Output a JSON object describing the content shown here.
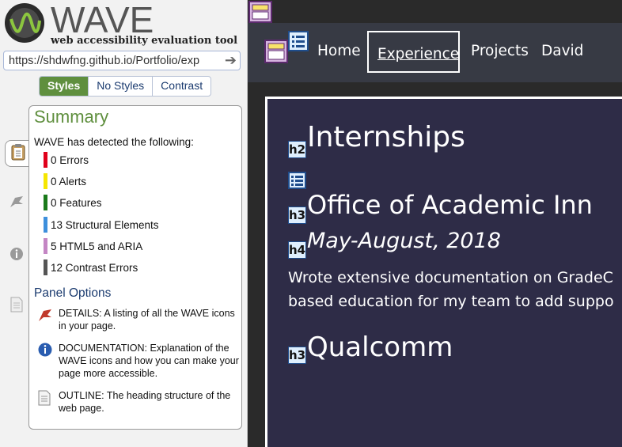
{
  "wave": {
    "logo_word": "WAVE",
    "tagline": "web accessibility evaluation tool",
    "url": "https://shdwfng.github.io/Portfolio/exp",
    "view_tabs": [
      {
        "label": "Styles",
        "active": true
      },
      {
        "label": "No Styles",
        "active": false
      },
      {
        "label": "Contrast",
        "active": false
      }
    ],
    "summary": {
      "title": "Summary",
      "intro": "WAVE has detected the following:",
      "stats": [
        {
          "label": "0 Errors",
          "color": "#e0001b"
        },
        {
          "label": "0 Alerts",
          "color": "#f5e600"
        },
        {
          "label": "0 Features",
          "color": "#1a7a1a"
        },
        {
          "label": "13 Structural Elements",
          "color": "#3d8fdc"
        },
        {
          "label": "5 HTML5 and ARIA",
          "color": "#c486c4"
        },
        {
          "label": "12 Contrast Errors",
          "color": "#555555"
        }
      ]
    },
    "panel_options": {
      "title": "Panel Options",
      "items": [
        {
          "icon": "flag-icon",
          "text": "DETAILS: A listing of all the WAVE icons in your page."
        },
        {
          "icon": "info-icon",
          "text": "DOCUMENTATION: Explanation of the WAVE icons and how you can make your page more accessible."
        },
        {
          "icon": "document-icon",
          "text": "OUTLINE: The heading structure of the web page."
        }
      ]
    },
    "side_icons": [
      "clipboard-icon",
      "flag-icon",
      "info-icon",
      "document-icon"
    ]
  },
  "site": {
    "nav": {
      "home": "Home",
      "experience": "Experience",
      "projects": "Projects",
      "david": "David"
    },
    "h2": {
      "badge": "h2",
      "text": "Internships"
    },
    "h3_1": {
      "badge": "h3",
      "text": "Office of Academic Inn"
    },
    "h4": {
      "badge": "h4",
      "text": "May-August, 2018"
    },
    "paragraph": {
      "line1": "Wrote extensive documentation on GradeC",
      "line2": "based education for my team to add suppo"
    },
    "h3_2": {
      "badge": "h3",
      "text": "Qualcomm"
    }
  },
  "colors": {
    "wave_green": "#5f8f3e",
    "wave_blue": "#1b3b6f",
    "site_nav_bg": "#373a44",
    "site_card_bg": "#2e2c47"
  }
}
